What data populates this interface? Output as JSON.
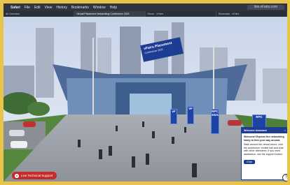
{
  "menubar": {
    "app": "Safari",
    "items": [
      "File",
      "Edit",
      "View",
      "History",
      "Bookmarks",
      "Window",
      "Help"
    ],
    "url": "live.vFairs.com"
  },
  "tabs": [
    {
      "label": "All Overview"
    },
    {
      "label": "Virtual Placement Networking Conference 2021"
    },
    {
      "label": "Home - vFairs"
    },
    {
      "label": "Showcase - vFairs"
    }
  ],
  "scene": {
    "banner_title": "vFairs Placement",
    "banner_subtitle": "Conference 2021",
    "flags": [
      "vF",
      "VF",
      "RPC 2021",
      "RPC"
    ]
  },
  "chat": {
    "title": "Welcome Assistant",
    "close": "×",
    "greeting": "Welcome! Explore the networking lobby to find your way around.",
    "body": "Walk around the virtual venue, visit the auditorium, exhibit hall and chat with other attendees. If you need assistance, use the support button.",
    "button": "Chat"
  },
  "support": {
    "label": "Live Technical Support"
  },
  "help": {
    "label": "?"
  }
}
